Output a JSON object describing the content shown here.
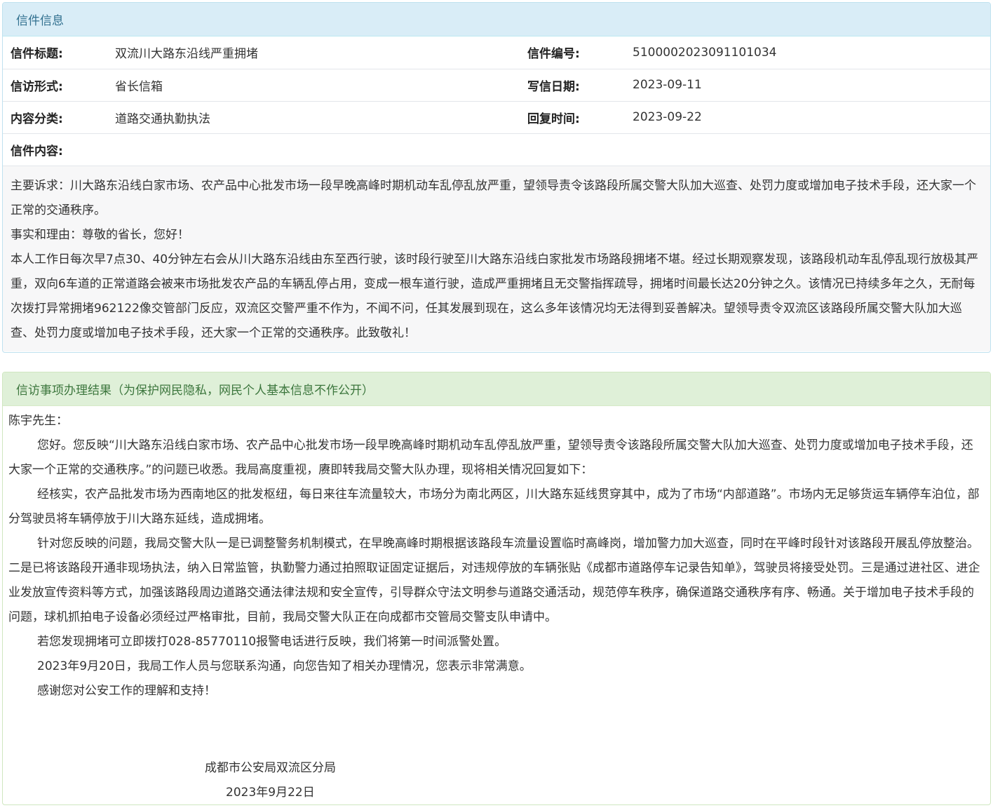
{
  "letter_info": {
    "heading": "信件信息",
    "rows": [
      {
        "label1": "信件标题:",
        "value1": "双流川大路东沿线严重拥堵",
        "label2": "信件编号:",
        "value2": "5100002023091101034"
      },
      {
        "label1": "信访形式:",
        "value1": "省长信箱",
        "label2": "写信日期:",
        "value2": "2023-09-11"
      },
      {
        "label1": "内容分类:",
        "value1": "道路交通执勤执法",
        "label2": "回复时间:",
        "value2": "2023-09-22"
      }
    ],
    "content_label": "信件内容:",
    "content_paragraphs": [
      "主要诉求：川大路东沿线白家市场、农产品中心批发市场一段早晚高峰时期机动车乱停乱放严重，望领导责令该路段所属交警大队加大巡查、处罚力度或增加电子技术手段，还大家一个正常的交通秩序。",
      "事实和理由：尊敬的省长，您好！",
      "本人工作日每次早7点30、40分钟左右会从川大路东沿线由东至西行驶，该时段行驶至川大路东沿线白家批发市场路段拥堵不堪。经过长期观察发现，该路段机动车乱停乱现行放极其严重，双向6车道的正常道路会被来市场批发农产品的车辆乱停占用，变成一根车道行驶，造成严重拥堵且无交警指挥疏导，拥堵时间最长达20分钟之久。该情况已持续多年之久，无耐每次拨打异常拥堵962122像交管部门反应，双流区交警严重不作为，不闻不问，任其发展到现在，这么多年该情况均无法得到妥善解决。望领导责令双流区该路段所属交警大队加大巡查、处罚力度或增加电子技术手段，还大家一个正常的交通秩序。此致敬礼！"
    ]
  },
  "result": {
    "heading": "信访事项办理结果（为保护网民隐私，网民个人基本信息不作公开）",
    "salutation": "陈宇先生：",
    "paragraphs": [
      "您好。您反映“川大路东沿线白家市场、农产品中心批发市场一段早晚高峰时期机动车乱停乱放严重，望领导责令该路段所属交警大队加大巡查、处罚力度或增加电子技术手段，还大家一个正常的交通秩序。”的问题已收悉。我局高度重视，赓即转我局交警大队办理，现将相关情况回复如下：",
      "经核实，农产品批发市场为西南地区的批发枢纽，每日来往车流量较大，市场分为南北两区，川大路东延线贯穿其中，成为了市场“内部道路”。市场内无足够货运车辆停车泊位，部分驾驶员将车辆停放于川大路东延线，造成拥堵。",
      "针对您反映的问题，我局交警大队一是已调整警务机制模式，在早晚高峰时期根据该路段车流量设置临时高峰岗，增加警力加大巡查，同时在平峰时段针对该路段开展乱停放整治。二是已将该路段开通非现场执法，纳入日常监管，执勤警力通过拍照取证固定证据后，对违规停放的车辆张贴《成都市道路停车记录告知单》，驾驶员将接受处罚。三是通过进社区、进企业发放宣传资料等方式，加强该路段周边道路交通法律法规和安全宣传，引导群众守法文明参与道路交通活动，规范停车秩序，确保道路交通秩序有序、畅通。关于增加电子技术手段的问题，球机抓拍电子设备必须经过严格审批，目前，我局交警大队正在向成都市交管局交警支队申请中。",
      "若您发现拥堵可立即拨打028-85770110报警电话进行反映，我们将第一时间派警处置。",
      "2023年9月20日，我局工作人员与您联系沟通，向您告知了相关办理情况，您表示非常满意。",
      "感谢您对公安工作的理解和支持！"
    ],
    "signature_org": "成都市公安局双流区分局",
    "signature_date": "2023年9月22日"
  }
}
